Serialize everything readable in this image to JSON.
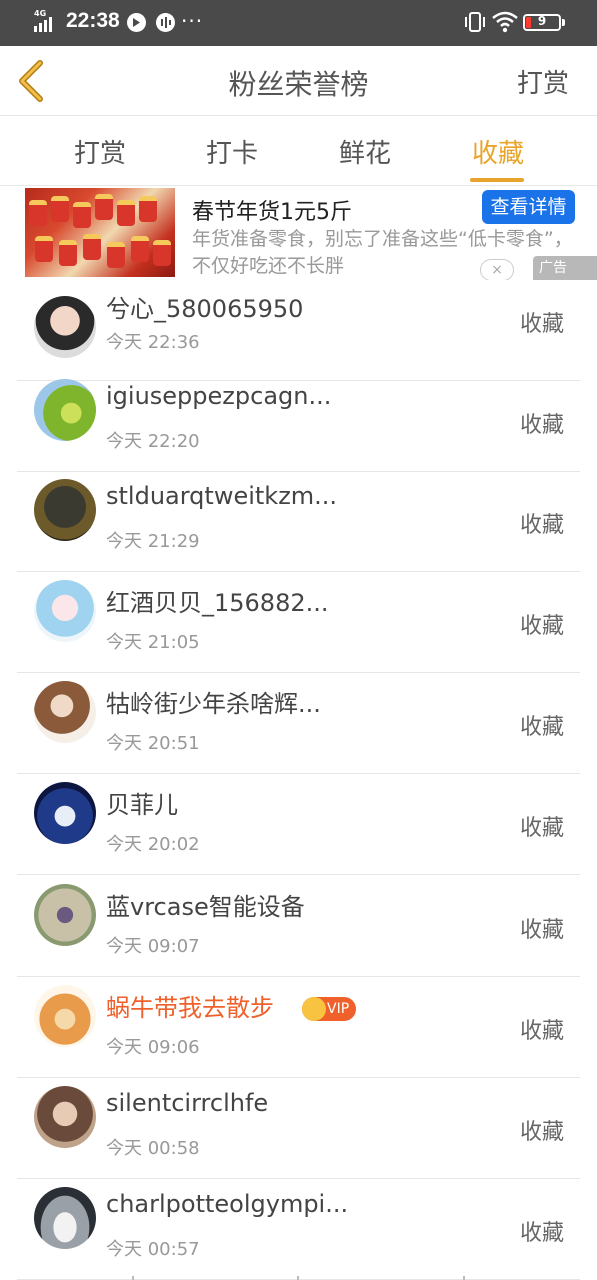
{
  "status_bar": {
    "network": "4G",
    "time": "22:38",
    "more": "···",
    "battery": "9",
    "battery_color": "#ff3b30"
  },
  "nav": {
    "back_icon": "chevron-left-icon",
    "title": "粉丝荣誉榜",
    "right_action": "打赏",
    "accent": "#e9a52b"
  },
  "tabs": [
    {
      "label": "打赏",
      "active": false
    },
    {
      "label": "打卡",
      "active": false
    },
    {
      "label": "鲜花",
      "active": false
    },
    {
      "label": "收藏",
      "active": true
    }
  ],
  "ad": {
    "title": "春节年货1元5斤",
    "description": "年货准备零食，别忘了准备这些“低卡零食”，不仅好吃还不长胖",
    "cta": "查看详情",
    "close": "×",
    "tag": "广告",
    "cta_color": "#1a73e8"
  },
  "rows": [
    {
      "name": "兮心_580065950",
      "time": "今天 22:36",
      "action": "收藏",
      "avatar": "girl-portrait"
    },
    {
      "name": "igiuseppezpcagn...",
      "time": "今天 22:20",
      "action": "收藏",
      "avatar": "green-leaf"
    },
    {
      "name": "stlduarqtweitkzm...",
      "time": "今天 21:29",
      "action": "收藏",
      "avatar": "dope-cap"
    },
    {
      "name": "红酒贝贝_156882...",
      "time": "今天 21:05",
      "action": "收藏",
      "avatar": "anime-girl"
    },
    {
      "name": "牯岭街少年杀啥辉...",
      "time": "今天 20:51",
      "action": "收藏",
      "avatar": "reading-girl"
    },
    {
      "name": "贝菲儿",
      "time": "今天 20:02",
      "action": "收藏",
      "avatar": "night-dress"
    },
    {
      "name": "蓝vrcase智能设备",
      "time": "今天 09:07",
      "action": "收藏",
      "avatar": "outdoor-person"
    },
    {
      "name": "蜗牛带我去散步",
      "time": "今天 09:06",
      "action": "收藏",
      "avatar": "shiba-dog",
      "vip": "VIP"
    },
    {
      "name": "silentcirrclhfe",
      "time": "今天 00:58",
      "action": "收藏",
      "avatar": "woman-portrait"
    },
    {
      "name": "charlpotteolgympi...",
      "time": "今天 00:57",
      "action": "收藏",
      "avatar": "sports-car"
    }
  ]
}
